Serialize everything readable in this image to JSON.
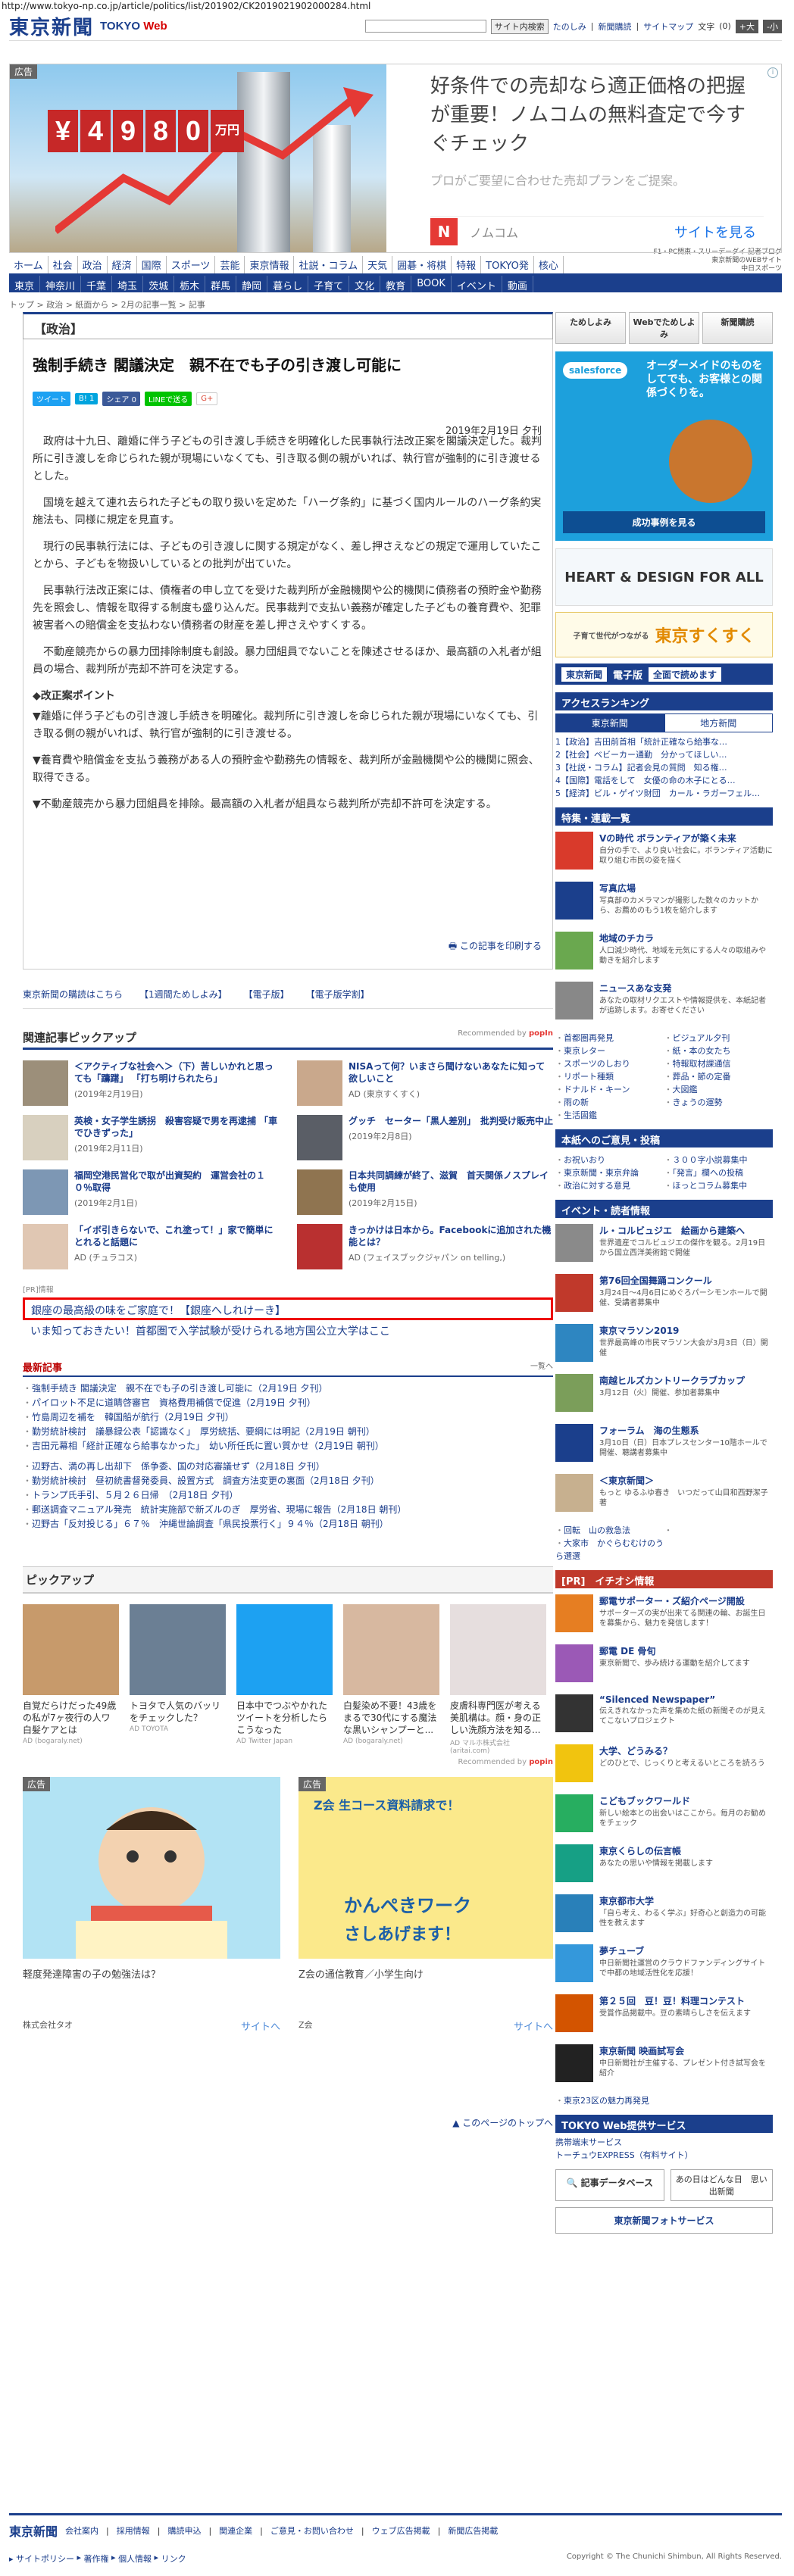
{
  "url": "http://www.tokyo-np.co.jp/article/politics/list/201902/CK2019021902000284.html",
  "header": {
    "logo": "東京新聞",
    "logo_web": "TOKYO",
    "logo_web2": "Web",
    "search_button": "サイト内検索",
    "links": [
      "たのしみ",
      "新聞購読",
      "サイトマップ"
    ],
    "font_label": "文字",
    "font_small": "(0)",
    "font_size_up": "+大",
    "font_size_down": "-小"
  },
  "top_ad": {
    "tag": "広告",
    "price_digits": [
      "¥",
      "4",
      "9",
      "8",
      "0",
      "万円"
    ],
    "headline": "好条件での売却なら適正価格の把握が重要！ノムコムの無料査定で今すぐチェック",
    "sub": "プロがご要望に合わせた売却プランをご提案。",
    "brand": "ノムコム",
    "cta": "サイトを見る"
  },
  "nav1": [
    "ホーム",
    "社会",
    "政治",
    "経済",
    "国際",
    "スポーツ",
    "芸能",
    "東京情報",
    "社説・コラム",
    "天気",
    "囲碁・将棋",
    "特報",
    "TOKYO発",
    "核心"
  ],
  "nav1_side": [
    "F1・PC関東・スリーデーダイ 記者ブログ",
    "東京新聞のWEBサイト",
    "中日スポーツ"
  ],
  "nav2": [
    "東京",
    "神奈川",
    "千葉",
    "埼玉",
    "茨城",
    "栃木",
    "群馬",
    "静岡",
    "暮らし",
    "子育て",
    "文化",
    "教育",
    "BOOK",
    "イベント",
    "動画"
  ],
  "breadcrumb": "トップ > 政治 > 紙面から > 2月の記事一覧 > 記事",
  "article": {
    "section": "【政治】",
    "title": "強制手続き 閣議決定　親不在でも子の引き渡し可能に",
    "share": [
      "ツイート",
      "B! 1",
      "シェア 0",
      "LINEで送る",
      "G+"
    ],
    "date": "2019年2月19日 夕刊",
    "paras": [
      "政府は十九日、離婚に伴う子どもの引き渡し手続きを明確化した民事執行法改正案を閣議決定した。裁判所に引き渡しを命じられた親が現場にいなくても、引き取る側の親がいれば、執行官が強制的に引き渡せるとした。",
      "国境を越えて連れ去られた子どもの取り扱いを定めた「ハーグ条約」に基づく国内ルールのハーグ条約実施法も、同様に規定を見直す。",
      "現行の民事執行法には、子どもの引き渡しに関する規定がなく、差し押さえなどの規定で運用していたことから、子どもを物扱いしているとの批判が出ていた。",
      "民事執行法改正案には、債権者の申し立てを受けた裁判所が金融機関や公的機関に債務者の預貯金や勤務先を照会し、情報を取得する制度も盛り込んだ。民事裁判で支払い義務が確定した子どもの養育費や、犯罪被害者への賠償金を支払わない債務者の財産を差し押さえやすくする。",
      "不動産競売からの暴力団排除制度も創設。暴力団組員でないことを陳述させるほか、最高額の入札者が組員の場合、裁判所が売却不許可を決定する。"
    ],
    "points_head": "◆改正案ポイント",
    "points": [
      "▼離婚に伴う子どもの引き渡し手続きを明確化。裁判所に引き渡しを命じられた親が現場にいなくても、引き取る側の親がいれば、執行官が強制的に引き渡せる。",
      "▼養育費や賠償金を支払う義務がある人の預貯金や勤務先の情報を、裁判所が金融機関や公的機関に照会、取得できる。",
      "▼不動産競売から暴力団組員を排除。最高額の入札者が組員なら裁判所が売却不許可を決定する。"
    ],
    "print": "この記事を印刷する"
  },
  "subscribe_links": [
    "東京新聞の購読はこちら",
    "【1週間ためしよみ】",
    "【電子版】",
    "【電子版学割】"
  ],
  "related": {
    "head": "関連記事ピックアップ",
    "rec": "Recommended by",
    "rec_brand": "popIn",
    "items": [
      {
        "t": "＜アクティブな社会へ＞（下）苦しいかれと思っても「躊躇」 「打ち明けられたら」",
        "d": "(2019年2月19日)"
      },
      {
        "t": "NISAって何？いまさら聞けないあなたに知って欲しいこと",
        "d": "AD (東京すくすく)"
      },
      {
        "t": "英検・女子学生誘拐　殺害容疑で男を再逮捕 「車でひきずった」",
        "d": "(2019年2月11日)"
      },
      {
        "t": "グッチ　セーター「黒人差別」　批判受け販売中止",
        "d": "(2019年2月8日)"
      },
      {
        "t": "福岡空港民営化で取が出資契約　運営会社の１０％取得",
        "d": "(2019年2月1日)"
      },
      {
        "t": "日本共同調練が終了、滋賀　首天関係ノスプレイも使用",
        "d": "(2019年2月15日)"
      },
      {
        "t": "「イボ引きらないで、これ塗って！」家で簡単にとれると話題に",
        "d": "AD (チュラコス)"
      },
      {
        "t": "きっかけは日本から。Facebookに追加された機能とは？",
        "d": "AD (フェイスブックジャパン on telling,)"
      }
    ],
    "pr_label": "[PR]情報",
    "pr_box": "銀座の最高級の味をご家庭で！【銀座へしれけーき】",
    "pr_line": "いま知っておきたい！首都圏で入学試験が受けられる地方国公立大学はここ"
  },
  "latest": {
    "head": "最新記事",
    "list_link": "一覧へ",
    "items": [
      "強制手続き 閣議決定　親不在でも子の引き渡し可能に（2月19日 夕刊）",
      "パイロット不足に道睛啓審官　資格費用補償で促進（2月19日 夕刊）",
      "竹島周辺を補を　韓国船が航行（2月19日 夕刊）",
      "勤労統計検討　議暴録公表「認識なく」　厚労統括、要綱には明記（2月19日 朝刊）",
      "吉田元幕相「経計正確なら給事なかった」　幼い所任氏に置い質かせ（2月19日 朝刊）",
      "",
      "辺野古、満の再し出却下　係争委、国の対応審議せず（2月18日 夕刊）",
      "勤労統計検討　昼初統書督発委員、設置方式　調査方法変更の裏面（2月18日 夕刊）",
      "トランプ氏手引、５月２６日帰　（2月18日 夕刊）",
      "郵送調査マニュアル発売　統計実施部で新ズルのぎ　厚労省、現場に報告（2月18日 朝刊）",
      "辺野古「反対投じる」６７％　沖縄世論調査「県民投票行く」９４％（2月18日 朝刊）"
    ]
  },
  "pickup": {
    "head": "ピックアップ",
    "items": [
      {
        "t": "自覚だらけだった49歳の私が7ヶ夜行の人ワ白髪ケアとは",
        "s": "AD (bogaraly.net)"
      },
      {
        "t": "トヨタで人気のバッリをチェックした？",
        "s": "AD TOYOTA"
      },
      {
        "t": "日本中でつぶやかれたツイートを分析したらこうなった",
        "s": "AD Twitter Japan"
      },
      {
        "t": "白髪染め不要！43歳をまるで30代にする魔法な黒いシャンプーと...",
        "s": "AD (bogaraly.net)"
      },
      {
        "t": "皮膚科専門医が考える美肌構は。顔・身の正しい洗顔方法を知る...",
        "s": "AD マルホ株式会社 (aritai.com)"
      }
    ],
    "rec": "Recommended by",
    "rec_brand": "popin"
  },
  "bottom_ads": [
    {
      "tag": "広告",
      "cap": "軽度発達障害の子の勉強法は？",
      "brand": "株式会社タオ",
      "cta": "サイトへ"
    },
    {
      "tag": "広告",
      "cap": "Z会の通信教育／小学生向け",
      "brand": "Z会",
      "cta": "サイトへ",
      "head": "Z会 生コース資料請求で！",
      "big": "かんぺきワーク",
      "sub": "さしあげます！"
    }
  ],
  "page_top": "このページのトップへ",
  "side": {
    "buttons": [
      "ためしよみ",
      "Webでためしよみ",
      "新聞購読"
    ],
    "ad_brand": "salesforce",
    "ad_text": "オーダーメイドのものをしてでも、お客様との関係づくりを。",
    "ad_cta": "成功事例を見る",
    "banner1": "HEART & DESIGN FOR ALL",
    "banner2": "東京すくすく",
    "banner2_small": "子育て世代がつながる",
    "banner3": "東京新聞",
    "banner3_tag": "電子版",
    "banner3_txt": "全面で読めます",
    "ranking_head": "アクセスランキング",
    "ranking_tabs": [
      "東京新聞",
      "地方新聞"
    ],
    "ranking": [
      "1【政治】吉田前首相「統計正確なら給事な…",
      "2【社会】ベビーカー通勤　分かってほしい…",
      "3【社説・コラム】記者会見の質問　知る権…",
      "4【国際】電話をして　女優の命の木子にとる…",
      "5【経済】ビル・ゲイツ財団　カール・ラガーフェル…"
    ],
    "special_head": "特集・連載一覧",
    "special": [
      {
        "t": "Vの時代 ボランティアが築く未来",
        "d": "自分の手で、より良い社会に。ボランティア活動に取り組む市民の姿を描く"
      },
      {
        "t": "写真広場",
        "d": "写真部のカメラマンが撮影した数々のカットから、お薦めのもう1枚を紹介します"
      },
      {
        "t": "地域のチカラ",
        "d": "人口減少時代、地域を元気にする人々の取組みや動きを紹介します"
      },
      {
        "t": "ニュースあな支発",
        "d": "あなたの取材リクエストや情報提供を、本紙記者が追跡します。お寄せください"
      }
    ],
    "special_list": [
      "首都圏再発見",
      "ピジュアル夕刊",
      "東京レター",
      "紙・本の女たち",
      "スポーツのしおり",
      "特報取材課通信",
      "リポート種類",
      "葬品・節の定番",
      "ドナルド・キーン",
      "大図鑑",
      "雨の新",
      "きょうの運勢",
      "生活図鑑",
      ""
    ],
    "service_head": "本紙へのご意見・投稿",
    "service": [
      "お祝いおり",
      "３００字小説募集中",
      "東京新聞・東京弁論",
      "「発言」欄への投稿",
      "政治に対する意見",
      "ほっとコラム募集中"
    ],
    "event_head": "イベント・読者情報",
    "events": [
      {
        "t": "ル・コルビュジエ　絵画から建築へ",
        "d": "世界遺産でコルビュジエの傑作を観る。2月19日から国立西洋美術館で開催"
      },
      {
        "t": "第76回全国舞踊コンクール",
        "d": "3月24日〜4月6日にめぐろパーシモンホールで開催、受講者募集中"
      },
      {
        "t": "東京マラソン2019",
        "d": "世界最高峰の市民マラソン大会が3月3日（日）開催"
      },
      {
        "t": "南越ヒルズカントリークラブカップ",
        "d": "3月12日（火）開催、参加者募集中"
      },
      {
        "t": "フォーラム　海の生態系",
        "d": "3月10日（日）日本プレスセンター10階ホールで開催、聴講者募集中"
      },
      {
        "t": "＜東京新聞＞",
        "d": "もっと ゆるふゆ春き　いつだって山目和西野潔子　著"
      }
    ],
    "event_list": [
      "回転　山の救急法",
      "大家市　かぐらむむけのうら選選"
    ],
    "pr_head": "[PR]　イチオシ情報",
    "prs": [
      {
        "t": "郵電サポーター・ズ紹介ページ開設",
        "d": "サポーターズの実が出来てる関連の輪、お誕生日を募集から、魅力を発信します！"
      },
      {
        "t": "郵電 DE 骨旬",
        "d": "東京新聞で、歩み続ける運動を紹介してます"
      },
      {
        "t": "“Silenced Newspaper”",
        "d": "伝えきれなかった声を集めた紙の新聞そのが見えてこないプロジェクト"
      },
      {
        "t": "大学、どうみる？",
        "d": "どのひとで、じっくりと考えるいところを読ろう"
      },
      {
        "t": "こどもブックワールド",
        "d": "新しい絵本との出会いはここから。毎月のお勧めをチェック"
      },
      {
        "t": "東京くらしの伝言帳",
        "d": "あなたの思いや情報を掲載します"
      },
      {
        "t": "東京都市大学",
        "d": "「自ら考え、わるく学ぶ」好奇心と創造力の可能性を教えます"
      },
      {
        "t": "夢チューブ",
        "d": "中日新聞社運営のクラウドファンディングサイトで中都の地域活性化を応援！"
      },
      {
        "t": "第２５回　豆！豆！料理コンテスト",
        "d": "受賞作品掲載中。豆の素晴らしさを伝えます"
      },
      {
        "t": "東京新聞 映画試写会",
        "d": "中日新聞社が主催する、プレゼント付き試写会を紹介"
      }
    ],
    "pr_list": [
      "東京23区の魅力再発見"
    ],
    "tokyoweb_head": "TOKYO Web提供サービス",
    "tokyoweb": [
      "携帯端末サービス",
      "トーチュウEXPRESS（有料サイト）"
    ],
    "db_btn": "記事データベース",
    "ad2": "あの日はどんな日　思い出新聞",
    "photo": "東京新聞フォトサービス"
  },
  "footer": {
    "logo": "東京新聞",
    "links": [
      "会社案内",
      "採用情報",
      "購読申込",
      "関連企業",
      "ご意見・お問い合わせ",
      "ウェブ広告掲載",
      "新聞広告掲載"
    ],
    "links2": [
      "サイトポリシー",
      "著作権",
      "個人情報",
      "リンク"
    ],
    "copyright": "Copyright © The Chunichi Shimbun, All Rights Reserved."
  }
}
